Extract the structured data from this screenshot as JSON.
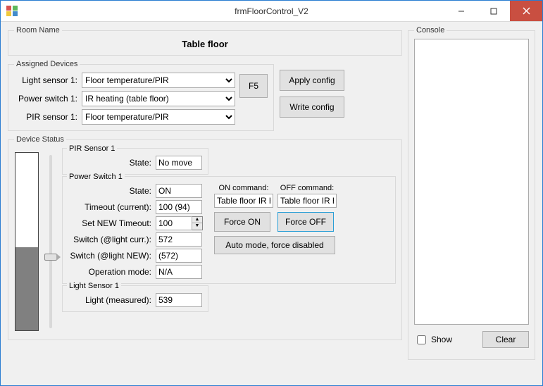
{
  "window": {
    "title": "frmFloorControl_V2"
  },
  "room": {
    "legend": "Room Name",
    "name": "Table floor"
  },
  "assigned": {
    "legend": "Assigned Devices",
    "labels": {
      "light": "Light sensor 1:",
      "power": "Power switch 1:",
      "pir": "PIR sensor 1:"
    },
    "values": {
      "light": "Floor temperature/PIR",
      "power": "IR heating (table floor)",
      "pir": "Floor temperature/PIR"
    },
    "f5": "F5",
    "apply": "Apply config",
    "write": "Write config"
  },
  "status": {
    "legend": "Device Status",
    "pir": {
      "legend": "PIR Sensor 1",
      "state_label": "State:",
      "state": "No move"
    },
    "power": {
      "legend": "Power Switch 1",
      "labels": {
        "state": "State:",
        "timeout_cur": "Timeout (current):",
        "timeout_new": "Set NEW Timeout:",
        "sw_cur": "Switch (@light curr.):",
        "sw_new": "Switch (@light NEW):",
        "op": "Operation mode:"
      },
      "values": {
        "state": "ON",
        "timeout_cur": "100 (94)",
        "timeout_new": "100",
        "sw_cur": "572",
        "sw_new": "(572)",
        "op": "N/A"
      },
      "cmd": {
        "on_hdr": "ON command:",
        "off_hdr": "OFF command:",
        "on_val": "Table floor IR h",
        "off_val": "Table floor IR h",
        "force_on": "Force ON",
        "force_off": "Force OFF",
        "auto": "Auto mode, force disabled"
      }
    },
    "light": {
      "legend": "Light Sensor 1",
      "label": "Light (measured):",
      "value": "539"
    }
  },
  "console": {
    "legend": "Console",
    "show": "Show",
    "clear": "Clear",
    "text": ""
  }
}
